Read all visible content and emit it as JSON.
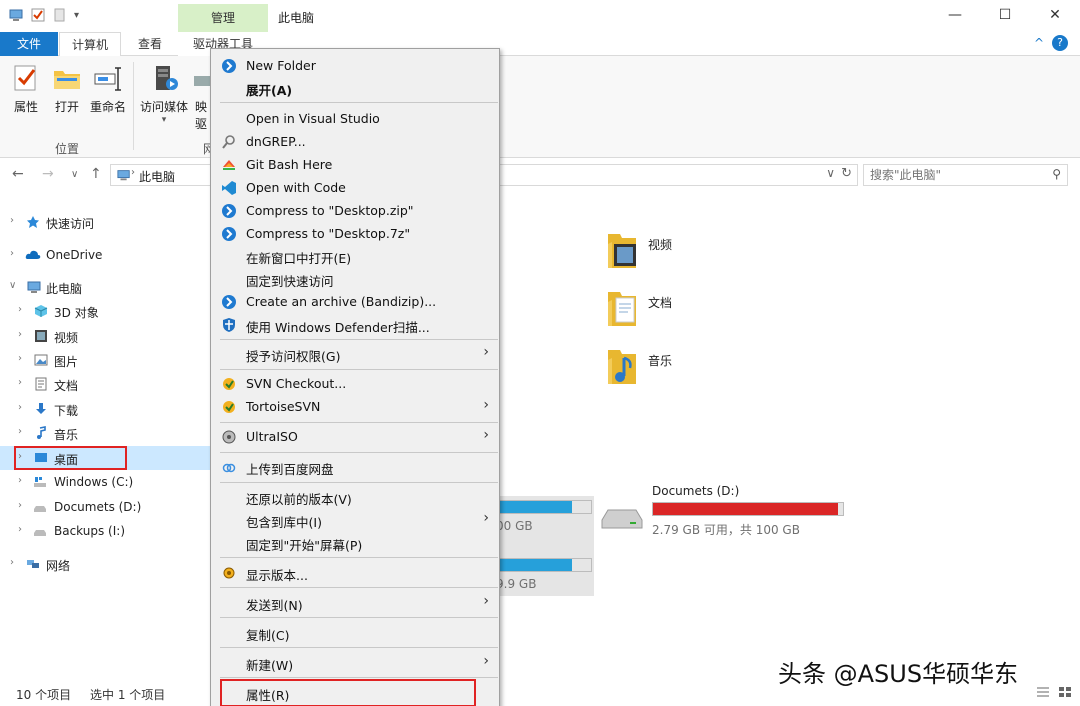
{
  "window": {
    "title": "此电脑",
    "contextual_tab_group": "管理",
    "minimize": "—",
    "maximize": "☐",
    "close": "✕"
  },
  "ribbon": {
    "tabs": {
      "file": "文件",
      "computer": "计算机",
      "view": "查看",
      "drive_tools": "驱动器工具"
    },
    "buttons": {
      "properties": "属性",
      "open": "打开",
      "rename": "重命名",
      "access_media": "访问媒体",
      "map": "映",
      "map_line2": "驱"
    },
    "group_location": "位置",
    "group_network": "网"
  },
  "address": {
    "back": "←",
    "forward": "→",
    "recent": "∨",
    "up": "↑",
    "crumb": "此电脑",
    "search_placeholder": "搜索\"此电脑\""
  },
  "nav_pane": {
    "items": [
      {
        "label": "快速访问",
        "icon": "star-icon"
      },
      {
        "label": "OneDrive",
        "icon": "cloud-icon"
      },
      {
        "label": "此电脑",
        "icon": "computer-icon"
      },
      {
        "label": "3D 对象",
        "icon": "cube-icon"
      },
      {
        "label": "视频",
        "icon": "video-icon"
      },
      {
        "label": "图片",
        "icon": "picture-icon"
      },
      {
        "label": "文档",
        "icon": "document-icon"
      },
      {
        "label": "下载",
        "icon": "download-icon"
      },
      {
        "label": "音乐",
        "icon": "music-icon"
      },
      {
        "label": "桌面",
        "icon": "desktop-icon"
      },
      {
        "label": "Windows (C:)",
        "icon": "drive-icon"
      },
      {
        "label": "Documets (D:)",
        "icon": "drive-icon"
      },
      {
        "label": "Backups (I:)",
        "icon": "drive-icon"
      },
      {
        "label": "网络",
        "icon": "network-icon"
      }
    ]
  },
  "content": {
    "folders": [
      {
        "label": "视频"
      },
      {
        "label": "文档"
      },
      {
        "label": "音乐"
      }
    ],
    "drives": [
      {
        "name": "Documets (D:)",
        "free_text": "2.79 GB 可用，共 100 GB",
        "used_fraction": 0.972,
        "color": "#da2626"
      },
      {
        "free_text": "00 GB",
        "used_fraction": 0.9,
        "color": "#26a0da"
      },
      {
        "free_text": "9.9 GB",
        "used_fraction": 0.9,
        "color": "#26a0da"
      }
    ]
  },
  "context_menu": {
    "items": [
      {
        "label": "New Folder",
        "icon": "bandizip-icon",
        "bold": false,
        "submenu": false
      },
      {
        "label": "展开(A)",
        "icon": "",
        "bold": true,
        "submenu": false
      },
      {
        "label": "Open in Visual Studio",
        "icon": "",
        "bold": false,
        "submenu": false
      },
      {
        "label": "dnGREP...",
        "icon": "magnifier-icon",
        "bold": false,
        "submenu": false
      },
      {
        "label": "Git Bash Here",
        "icon": "git-icon",
        "bold": false,
        "submenu": false
      },
      {
        "label": "Open with Code",
        "icon": "vscode-icon",
        "bold": false,
        "submenu": false
      },
      {
        "label": "Compress to \"Desktop.zip\"",
        "icon": "bandizip-icon",
        "bold": false,
        "submenu": false
      },
      {
        "label": "Compress to \"Desktop.7z\"",
        "icon": "bandizip-icon",
        "bold": false,
        "submenu": false
      },
      {
        "label": "在新窗口中打开(E)",
        "icon": "",
        "bold": false,
        "submenu": false
      },
      {
        "label": "固定到快速访问",
        "icon": "",
        "bold": false,
        "submenu": false
      },
      {
        "label": "Create an archive (Bandizip)...",
        "icon": "bandizip-icon",
        "bold": false,
        "submenu": false
      },
      {
        "label": "使用 Windows Defender扫描...",
        "icon": "defender-icon",
        "bold": false,
        "submenu": false
      },
      {
        "label": "授予访问权限(G)",
        "icon": "",
        "bold": false,
        "submenu": true
      },
      {
        "label": "SVN Checkout...",
        "icon": "svn-icon",
        "bold": false,
        "submenu": false
      },
      {
        "label": "TortoiseSVN",
        "icon": "svn-icon",
        "bold": false,
        "submenu": true
      },
      {
        "label": "UltraISO",
        "icon": "ultraiso-icon",
        "bold": false,
        "submenu": true
      },
      {
        "label": "上传到百度网盘",
        "icon": "baidu-cloud-icon",
        "bold": false,
        "submenu": false
      },
      {
        "label": "还原以前的版本(V)",
        "icon": "",
        "bold": false,
        "submenu": false
      },
      {
        "label": "包含到库中(I)",
        "icon": "",
        "bold": false,
        "submenu": true
      },
      {
        "label": "固定到\"开始\"屏幕(P)",
        "icon": "",
        "bold": false,
        "submenu": false
      },
      {
        "label": "显示版本...",
        "icon": "version-icon",
        "bold": false,
        "submenu": false
      },
      {
        "label": "发送到(N)",
        "icon": "",
        "bold": false,
        "submenu": true
      },
      {
        "label": "复制(C)",
        "icon": "",
        "bold": false,
        "submenu": false
      },
      {
        "label": "新建(W)",
        "icon": "",
        "bold": false,
        "submenu": true
      },
      {
        "label": "属性(R)",
        "icon": "",
        "bold": false,
        "submenu": false
      }
    ]
  },
  "status": {
    "item_count": "10 个项目",
    "selected": "选中 1 个项目"
  },
  "watermark": "头条 @ASUS华硕华东",
  "colors": {
    "accent": "#1979ca",
    "selection": "#cce8ff",
    "highlight_outline": "#e02323",
    "drive_full": "#da2626",
    "drive_normal": "#26a0da"
  }
}
